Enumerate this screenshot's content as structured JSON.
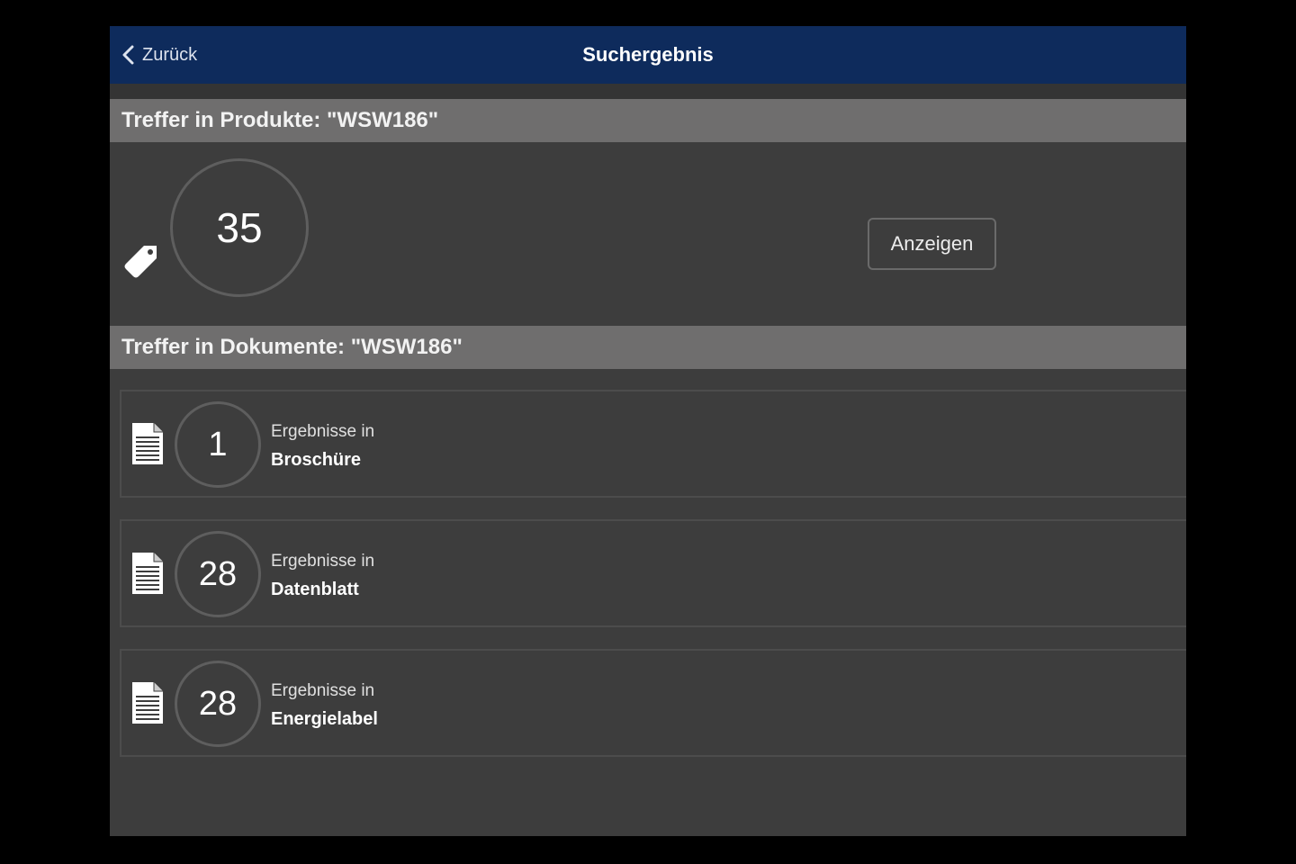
{
  "navbar": {
    "back_label": "Zurück",
    "title": "Suchergebnis"
  },
  "products": {
    "header": "Treffer in Produkte: \"WSW186\"",
    "count": "35",
    "show_label": "Anzeigen"
  },
  "documents": {
    "header": "Treffer in Dokumente: \"WSW186\"",
    "items": [
      {
        "count": "1",
        "prefix": "Ergebnisse in",
        "name": "Broschüre"
      },
      {
        "count": "28",
        "prefix": "Ergebnisse in",
        "name": "Datenblatt"
      },
      {
        "count": "28",
        "prefix": "Ergebnisse in",
        "name": "Energielabel"
      }
    ]
  },
  "colors": {
    "navbar": "#0e2b5c",
    "background": "#3d3d3d",
    "section_header": "#6f6e6e"
  },
  "icons": {
    "back": "chevron-left-icon",
    "product": "price-tag-icon",
    "document": "document-icon"
  }
}
